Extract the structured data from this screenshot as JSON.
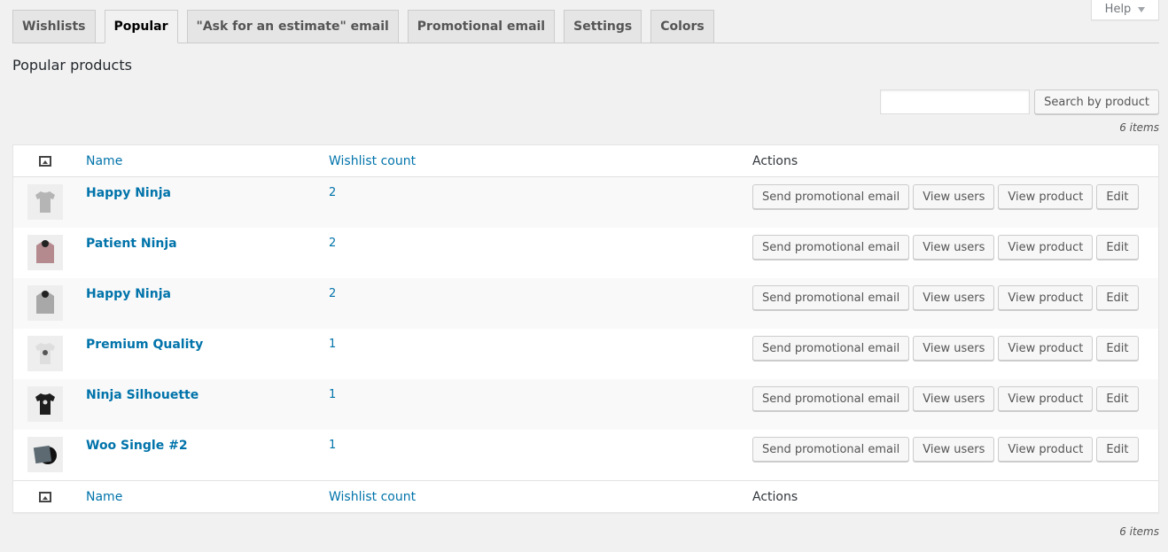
{
  "help": {
    "label": "Help"
  },
  "tabs": [
    {
      "label": "Wishlists",
      "active": false
    },
    {
      "label": "Popular",
      "active": true
    },
    {
      "label": "\"Ask for an estimate\" email",
      "active": false
    },
    {
      "label": "Promotional email",
      "active": false
    },
    {
      "label": "Settings",
      "active": false
    },
    {
      "label": "Colors",
      "active": false
    }
  ],
  "page_title": "Popular products",
  "search": {
    "value": "",
    "placeholder": "",
    "button_label": "Search by product"
  },
  "items_count": "6 items",
  "table": {
    "columns": {
      "thumb_icon": "image-icon",
      "name": "Name",
      "count": "Wishlist count",
      "actions": "Actions"
    },
    "actions": {
      "send_email": "Send promotional email",
      "view_users": "View users",
      "view_product": "View product",
      "edit": "Edit"
    },
    "rows": [
      {
        "name": "Happy Ninja",
        "count": "2",
        "thumb": "gray-tshirt"
      },
      {
        "name": "Patient Ninja",
        "count": "2",
        "thumb": "pink-hoodie"
      },
      {
        "name": "Happy Ninja",
        "count": "2",
        "thumb": "gray-hoodie"
      },
      {
        "name": "Premium Quality",
        "count": "1",
        "thumb": "white-tshirt"
      },
      {
        "name": "Ninja Silhouette",
        "count": "1",
        "thumb": "black-tshirt"
      },
      {
        "name": "Woo Single #2",
        "count": "1",
        "thumb": "vinyl-record"
      }
    ]
  },
  "colors": {
    "link": "#0073aa",
    "background": "#f1f1f1",
    "alt_row": "#f9f9f9",
    "thumb_gray_tshirt": "#b5b5b5",
    "thumb_pink_hoodie": "#b58a8f",
    "thumb_gray_hoodie": "#a8a8a8",
    "thumb_white_tshirt": "#dedede",
    "thumb_black_tshirt": "#1e1e1e",
    "thumb_vinyl": "#5d6a72"
  }
}
